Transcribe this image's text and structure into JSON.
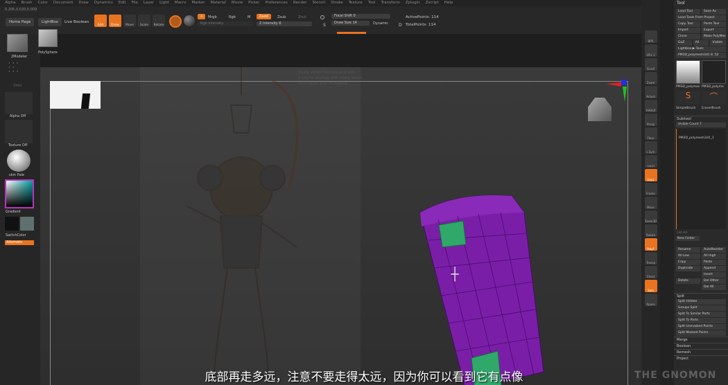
{
  "menubar": [
    "Alpha",
    "Brush",
    "Color",
    "Document",
    "Draw",
    "Dynamics",
    "Edit",
    "File",
    "Layer",
    "Light",
    "Macro",
    "Marker",
    "Material",
    "Movie",
    "Picker",
    "Preferences",
    "Render",
    "Stencil",
    "Stroke",
    "Texture",
    "Tool",
    "Transform",
    "Zplugin",
    "Zscript",
    "Help"
  ],
  "coords": "0.205,0.020,0.009",
  "topbar": {
    "home": "Home Page",
    "lightbox": "LightBox",
    "boolean": "Live Boolean",
    "modes": [
      "Edit",
      "Draw",
      "Move",
      "Scale",
      "Rotate"
    ],
    "a_label": "A",
    "mrgb": "Mrgb",
    "rgb": "Rgb",
    "m": "M",
    "zadd": "Zadd",
    "zsub": "Zsub",
    "zcut": "Zcut",
    "rgb_intensity": "Rgb Intensity",
    "z_intensity": "Z Intensity 6",
    "focal_shift": "Focal Shift 0",
    "draw_size": "Draw Size 14",
    "dynamic": "Dynamic",
    "active_points": "ActivePoints: 114",
    "total_points": "TotalPoints: 114",
    "s_key": "S",
    "d_key": "D"
  },
  "left": {
    "tool_label": "2Modeler",
    "poly_label": "PolySphere",
    "dots_label": "Dots",
    "alpha": "Alpha Off",
    "texture": "Texture Off",
    "material": "skin Pale",
    "gradient": "Gradient",
    "switch": "SwitchColor",
    "alternate": "Alternate"
  },
  "strip": [
    "BPR",
    "SPix 3",
    "Scroll",
    "Zoom",
    "Actual",
    "AAHalf",
    "Persp",
    "Floor",
    "L.Sym",
    "Local",
    "Gxyz",
    "Frame",
    "Move",
    "Zoom3D",
    "Rotate",
    "PolyF",
    "Transp",
    "Ghost",
    "Solo",
    "Xpose"
  ],
  "rightpanel": {
    "title": "Tool",
    "rows": [
      [
        "Load Tool",
        "Save As"
      ],
      [
        "Load Tools From Project"
      ],
      [
        "Copy Tool",
        "Paste Tool"
      ],
      [
        "Import",
        "Export"
      ],
      [
        "Clone",
        "Make PolyMesh3D"
      ],
      [
        "GoZ",
        "All",
        "Visible"
      ],
      [
        "Lightbox ▶ Tools"
      ],
      [
        "PM3D_polymesh3d1 8. 52"
      ]
    ],
    "thumb1": "PM3D_polymes",
    "thumb2": "PM3D_polyme",
    "simplebrush": "SimpleBrush",
    "eraserbrush": "EraserBrush",
    "subtool": "Subtool",
    "visible_count": "Visible Count 7",
    "subtool_item": "PM3D_polymesh3d1_1",
    "list_all": "List All",
    "new_folder": "New Folder",
    "rows2": [
      [
        "Rename",
        "AutoReorder"
      ],
      [
        "All Low",
        "All High"
      ],
      [
        "Copy",
        "Paste"
      ],
      [
        "Duplicate",
        "Append"
      ],
      [
        "",
        "Insert"
      ],
      [
        "Delete",
        "Del Other"
      ],
      [
        "",
        "Del All"
      ]
    ],
    "split": "Split",
    "split_items": [
      "Split Hidden",
      "Groups Split",
      "Split To Similar Parts",
      "Split To Parts",
      "Split Unmasked Points",
      "Split Masked Points"
    ],
    "merge": "Merge",
    "boolean": "Boolean",
    "remesh": "Remesh",
    "project": "Project"
  },
  "overlay_text": [
    "Study single forming and not",
    "If you're dealing with sharp mesh",
    "Its original goal of leading"
  ],
  "subtitle": "底部再走多远，注意不要走得太远，因为你可以看到它有点像",
  "watermark": "THE GNOMON",
  "colors": {
    "accent": "#e8741f",
    "purple": "#7a1ea8",
    "green": "#2fa86a"
  }
}
